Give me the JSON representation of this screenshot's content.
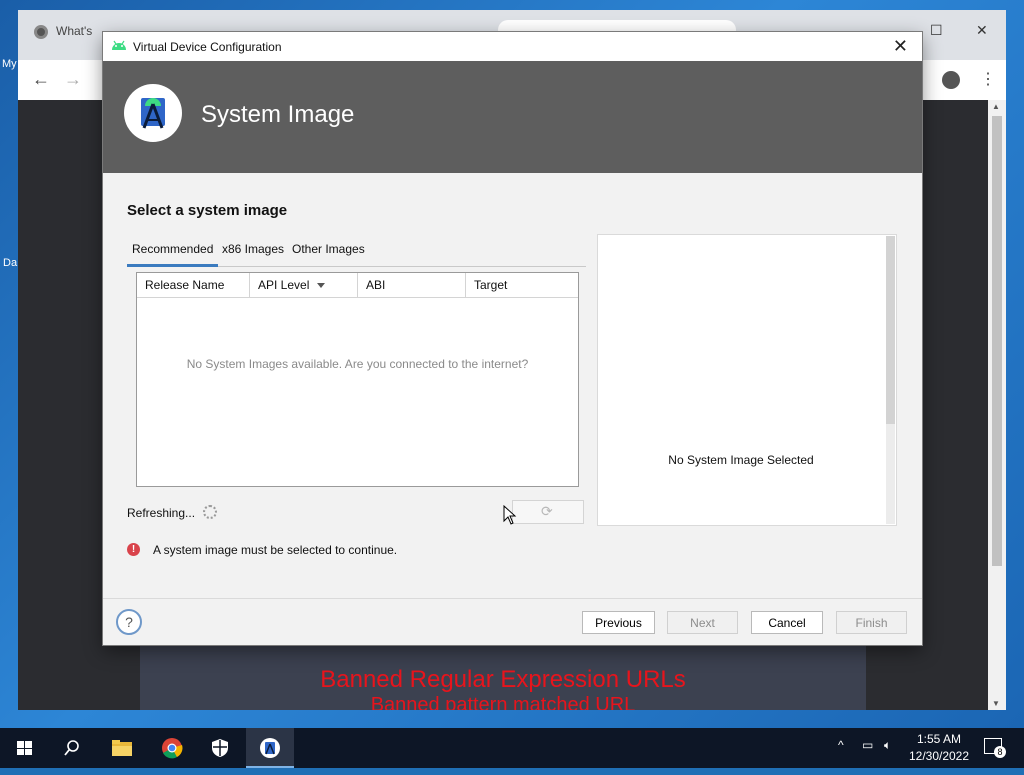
{
  "desktop": {
    "labels": [
      "My",
      "Da"
    ]
  },
  "browser": {
    "tab_title": "What's",
    "controls": [
      "⌄",
      "–",
      "☐",
      "✕"
    ],
    "nav": {
      "back": "←",
      "forward": "→"
    },
    "banner_title": "Banned Regular Expression URLs",
    "banner_subtitle": "Banned pattern matched URL"
  },
  "dialog": {
    "window_title": "Virtual Device Configuration",
    "close_glyph": "✕",
    "header_title": "System Image",
    "section_title": "Select a system image",
    "tabs": [
      {
        "label": "Recommended",
        "selected": true
      },
      {
        "label": "x86 Images",
        "selected": false
      },
      {
        "label": "Other Images",
        "selected": false
      }
    ],
    "table": {
      "columns": [
        "Release Name",
        "API Level",
        "ABI",
        "Target"
      ],
      "sorted_column": "API Level",
      "empty_message": "No System Images available. Are you connected to the internet?"
    },
    "refresh_status": "Refreshing...",
    "error_message": "A system image must be selected to continue.",
    "preview_message": "No System Image Selected",
    "buttons": {
      "help": "?",
      "previous": "Previous",
      "next": "Next",
      "cancel": "Cancel",
      "finish": "Finish"
    },
    "colors": {
      "header_bg": "#5e5e5e",
      "tab_accent": "#3b7bbf",
      "error": "#d9434b"
    }
  },
  "taskbar": {
    "time": "1:55 AM",
    "date": "12/30/2022",
    "notification_count": "8",
    "apps": [
      "search-icon",
      "file-explorer-icon",
      "chrome-icon",
      "security-icon",
      "android-studio-icon"
    ]
  }
}
